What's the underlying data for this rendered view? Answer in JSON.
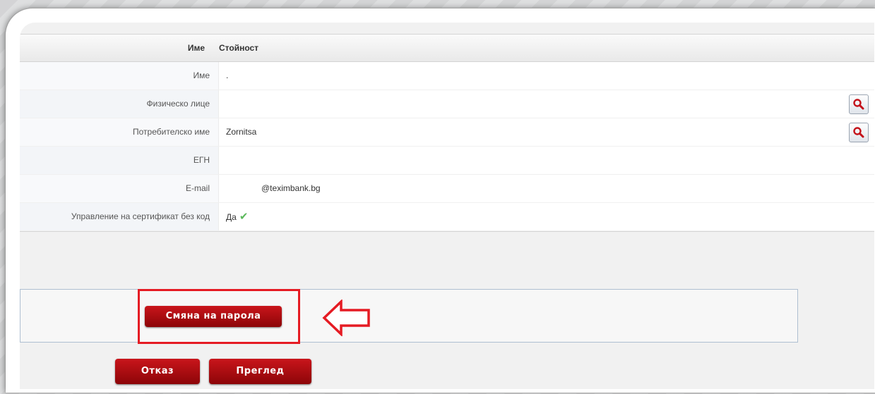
{
  "table": {
    "header": {
      "name_col": "Име",
      "value_col": "Стойност"
    },
    "rows": [
      {
        "label": "Име",
        "value": "."
      },
      {
        "label": "Физическо лице",
        "value": ""
      },
      {
        "label": "Потребителско име",
        "value": "Zornitsa"
      },
      {
        "label": "ЕГН",
        "value": ""
      },
      {
        "label": "E-mail",
        "value": "@teximbank.bg"
      },
      {
        "label": "Управление на сертификат без код",
        "value": "Да"
      }
    ]
  },
  "buttons": {
    "change_password": "Смяна на парола",
    "cancel": "Отказ",
    "preview": "Преглед"
  },
  "icons": {
    "lookup": "magnifier-icon",
    "check": "check-icon",
    "arrow": "left-arrow-icon"
  },
  "colors": {
    "accent_red": "#b10a10",
    "highlight_red": "#e51b23"
  }
}
